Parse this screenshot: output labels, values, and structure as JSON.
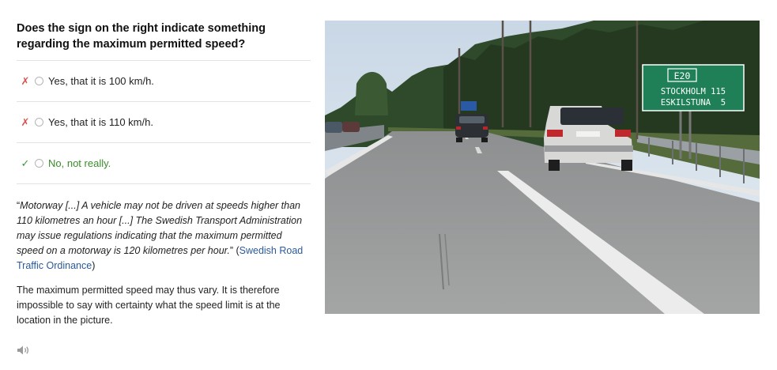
{
  "question": "Does the sign on the right indicate something regarding the maximum permitted speed?",
  "options": [
    {
      "mark": "✗",
      "label": "Yes, that it is 100 km/h.",
      "correct": false
    },
    {
      "mark": "✗",
      "label": "Yes, that it is 110 km/h.",
      "correct": false
    },
    {
      "mark": "✓",
      "label": "No, not really.",
      "correct": true
    }
  ],
  "quote": {
    "open": "“",
    "text": "Motorway [...] A vehicle may not be driven at speeds higher than 110 kilometres an hour [...] The Swedish Transport Administration may issue regulations indicating that the maximum permitted speed on a motorway is 120 kilometres per hour.",
    "close": "” ",
    "source_open": "(",
    "source": "Swedish Road Traffic Ordinance",
    "source_close": ")"
  },
  "explanation": "The maximum permitted speed may thus vary. It is therefore impossible to say with certainty what the speed limit is at the location in the picture.",
  "audio_icon": "speaker-icon",
  "sign": {
    "route": "E20",
    "line1": "STOCKHOLM 115",
    "line2": "ESKILSTUNA  5"
  },
  "colors": {
    "wrong": "#d9534f",
    "correct": "#3a8d2a",
    "link": "#2a5a9a",
    "sign_green": "#1f7f57"
  }
}
